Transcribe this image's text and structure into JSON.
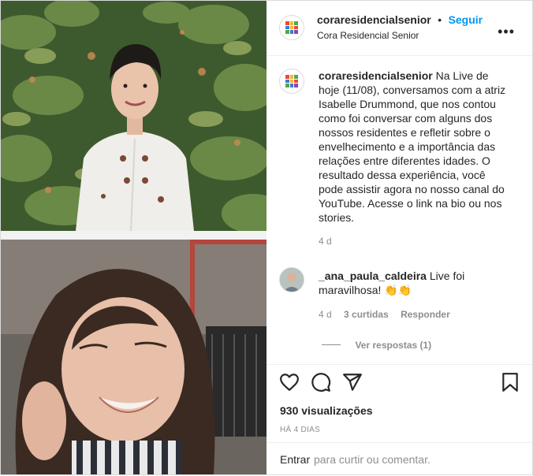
{
  "post": {
    "username": "coraresidencialsenior",
    "follow_label": "Seguir",
    "dot": "•",
    "location": "Cora Residencial Senior",
    "more_label": "•••"
  },
  "caption": {
    "username": "coraresidencialsenior",
    "text": "Na Live de hoje (11/08), conversamos com a atriz Isabelle Drummond, que nos contou como foi conversar com alguns dos nossos residentes e refletir sobre o envelhecimento e a importância das relações entre diferentes idades. O resultado dessa experiência, você pode assistir agora no nosso canal do YouTube. Acesse o link na bio ou nos stories.",
    "age": "4 d"
  },
  "comment": {
    "username": "_ana_paula_caldeira",
    "text": "Live foi maravilhosa! 👏👏",
    "age": "4 d",
    "likes": "3 curtidas",
    "reply_label": "Responder",
    "view_replies": "Ver respostas (1)"
  },
  "actions": {
    "views": "930 visualizações",
    "date": "HÁ 4 DIAS"
  },
  "add_comment": {
    "login_link": "Entrar",
    "prompt": "para curtir ou comentar."
  },
  "colors": {
    "accent": "#0095f6",
    "text": "#262626",
    "muted": "#8e8e8e",
    "border": "#dbdbdb"
  }
}
